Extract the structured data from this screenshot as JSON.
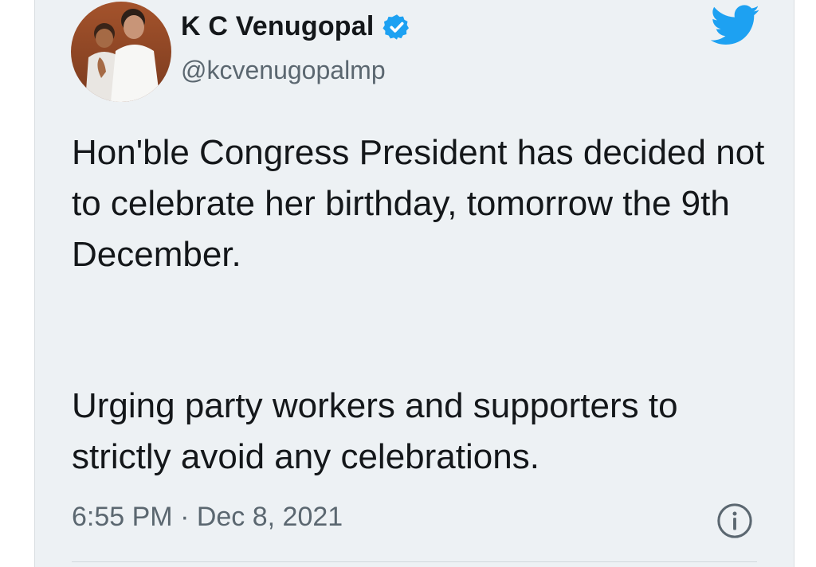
{
  "tweet": {
    "author_name": "K C Venugopal",
    "handle": "@kcvenugopalmp",
    "text_paragraph_1": "Hon'ble Congress President has decided not to celebrate her birthday, tomorrow the 9th December.",
    "text_paragraph_2": "Urging party workers and supporters to strictly avoid any celebrations.",
    "timestamp": "6:55 PM · Dec 8, 2021"
  },
  "icons": {
    "avatar": "profile-photo",
    "verified": "verified-badge-icon",
    "brand": "twitter-bird-icon",
    "info": "info-icon"
  },
  "colors": {
    "card_background": "#edf1f4",
    "twitter_blue": "#1da1f2",
    "text_primary": "#14171a",
    "text_secondary": "#5b6770"
  }
}
